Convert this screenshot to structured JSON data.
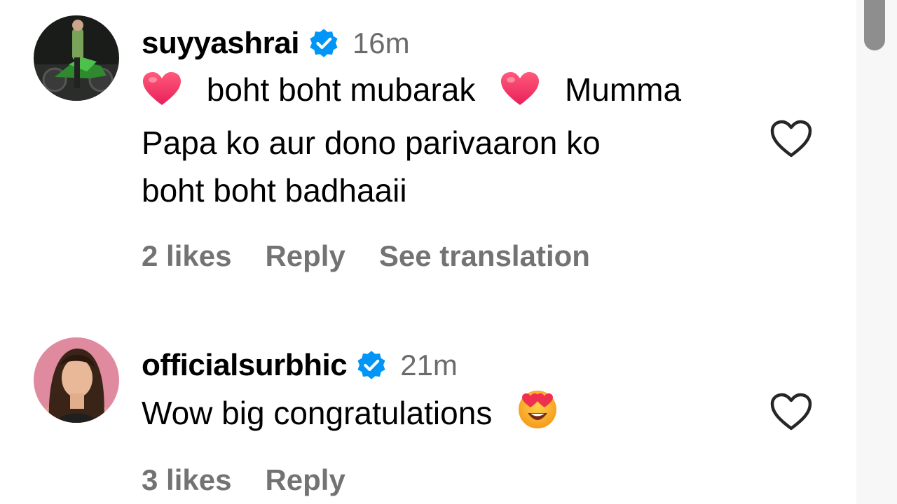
{
  "comments": [
    {
      "username": "suyyashrai",
      "verified": true,
      "timestamp": "16m",
      "lines": [
        {
          "pre": "",
          "mid": "boht boht mubarak",
          "post": "Mumma"
        },
        {
          "text": "Papa ko aur dono parivaaron ko"
        },
        {
          "text": "boht boht badhaaii"
        }
      ],
      "emojis": [
        "heart-emoji",
        "heart-emoji"
      ],
      "likes": "2 likes",
      "reply": "Reply",
      "see_translation": "See translation"
    },
    {
      "username": "officialsurbhic",
      "verified": true,
      "timestamp": "21m",
      "text": "Wow big congratulations",
      "emojis": [
        "heart-eyes-emoji"
      ],
      "likes": "3 likes",
      "reply": "Reply"
    }
  ],
  "colors": {
    "verified_blue": "#0095f6",
    "muted_text": "#737373",
    "timestamp_text": "#6b6b6b",
    "heart_pink": "#f7305b",
    "scroll_thumb": "#8e8e8e"
  }
}
